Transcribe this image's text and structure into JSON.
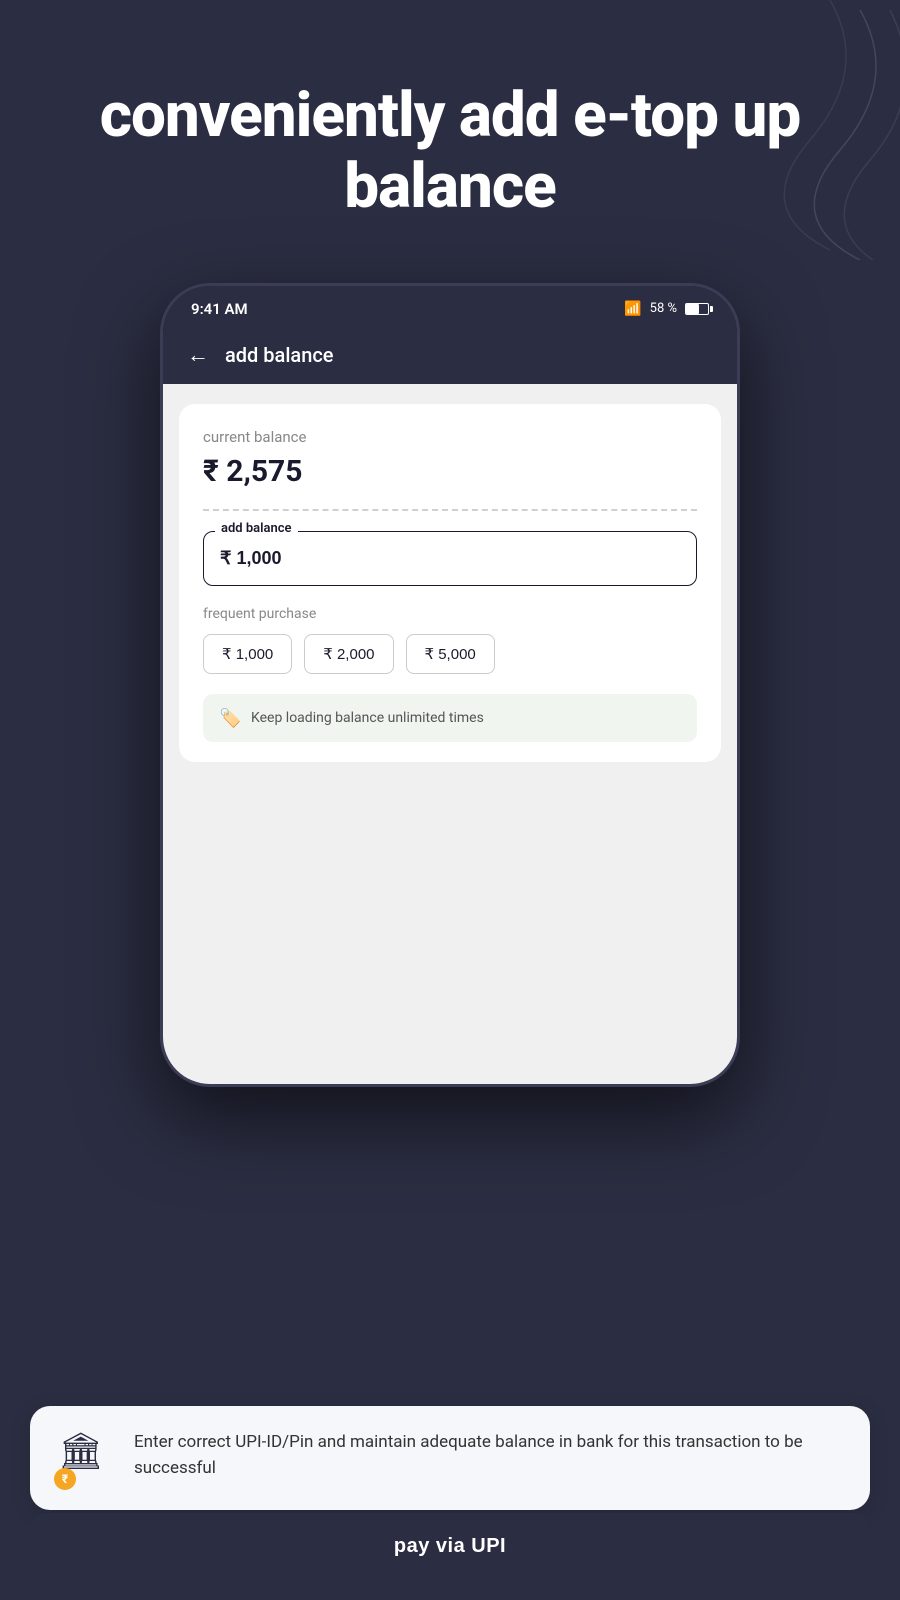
{
  "page": {
    "background_color": "#2b2d42",
    "header": {
      "title": "conveniently add e-top up balance"
    }
  },
  "status_bar": {
    "time": "9:41 AM",
    "wifi": "WiFi",
    "battery_percent": "58 %"
  },
  "navbar": {
    "back_label": "←",
    "title": "add balance"
  },
  "balance_card": {
    "current_balance_label": "current balance",
    "current_balance_amount": "₹ 2,575",
    "input_label": "add balance",
    "input_value": "₹ 1,000",
    "frequent_label": "frequent purchase",
    "amounts": [
      {
        "label": "₹ 1,000"
      },
      {
        "label": "₹ 2,000"
      },
      {
        "label": "₹ 5,000"
      }
    ],
    "info_text": "Keep loading balance unlimited times"
  },
  "notification": {
    "text": "Enter correct UPI-ID/Pin and maintain adequate balance in bank for this transaction to be successful"
  },
  "bottom_button": {
    "label": "pay via UPI"
  },
  "icons": {
    "back_arrow": "←",
    "bookmark": "🏷",
    "bank": "🏛",
    "coin": "₹",
    "wifi": "📶"
  }
}
